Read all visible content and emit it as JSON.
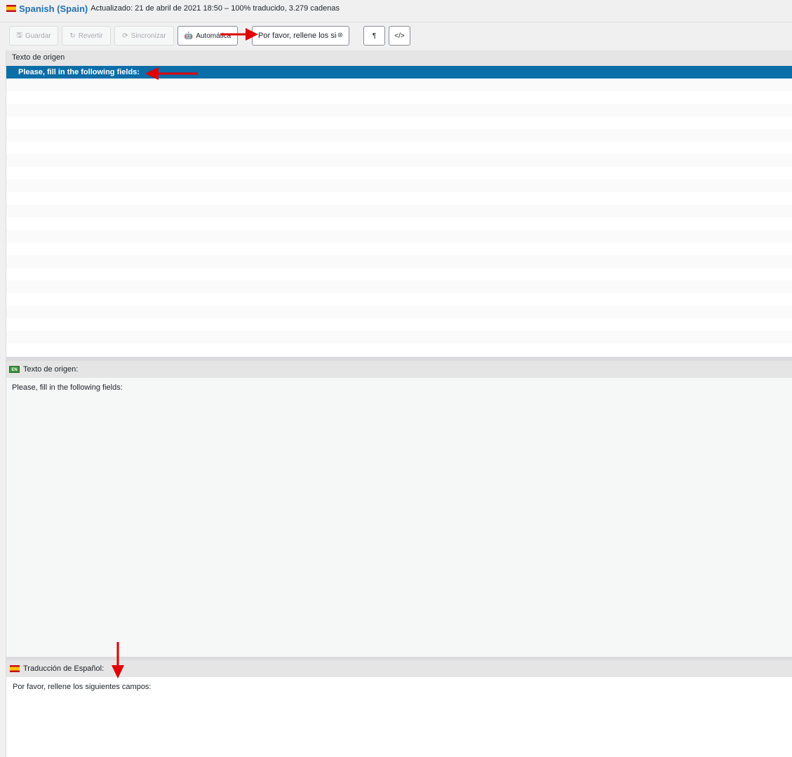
{
  "header": {
    "language": "Spanish (Spain)",
    "meta": "Actualizado: 21 de abril de 2021 18:50 – 100% traducido, 3.279 cadenas"
  },
  "toolbar": {
    "save_label": "Guardar",
    "revert_label": "Revertir",
    "sync_label": "Sincronizar",
    "auto_label": "Automática",
    "search_value": "Por favor, rellene los sig",
    "pilcrow_label": "¶",
    "code_label": "</>",
    "icons": {
      "save": "save-icon",
      "revert": "revert-icon",
      "sync": "sync-icon",
      "auto": "robot-icon",
      "clear": "clear-icon"
    }
  },
  "list": {
    "header": "Texto de origen",
    "rows": [
      "Please, fill in the following fields:"
    ]
  },
  "source": {
    "lang_badge": "EN",
    "header": "Texto de origen:",
    "text": "Please, fill in the following fields:"
  },
  "translation": {
    "header": "Traducción de Español:",
    "text": "Por favor, rellene los siguientes campos:"
  },
  "colors": {
    "accent": "#2271b1",
    "selected_row": "#0b6ea8",
    "annotation": "#e00000"
  }
}
